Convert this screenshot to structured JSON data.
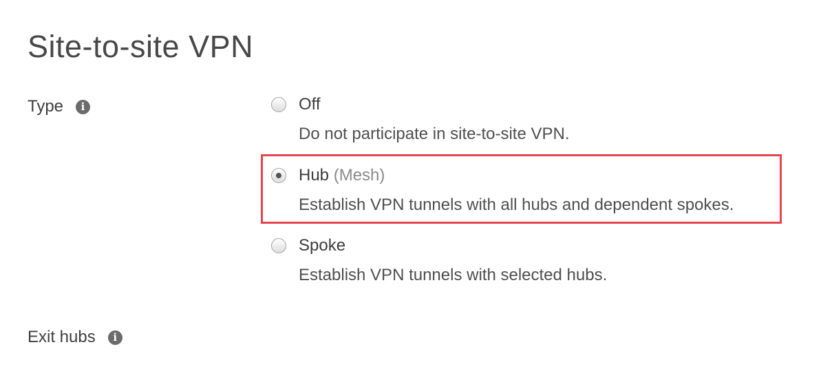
{
  "page": {
    "title": "Site-to-site VPN"
  },
  "type_field": {
    "label": "Type",
    "info_icon": "info-icon",
    "selected": "hub",
    "options": [
      {
        "id": "off",
        "label": "Off",
        "suffix": "",
        "description": "Do not participate in site-to-site VPN.",
        "checked": false
      },
      {
        "id": "hub",
        "label": "Hub",
        "suffix": "(Mesh)",
        "description": "Establish VPN tunnels with all hubs and dependent spokes.",
        "checked": true
      },
      {
        "id": "spoke",
        "label": "Spoke",
        "suffix": "",
        "description": "Establish VPN tunnels with selected hubs.",
        "checked": false
      }
    ]
  },
  "exit_hubs_field": {
    "label": "Exit hubs",
    "info_icon": "info-icon"
  },
  "colors": {
    "highlight_border": "#e5434c",
    "info_icon_bg": "#6b6b6b",
    "text": "#444444"
  }
}
